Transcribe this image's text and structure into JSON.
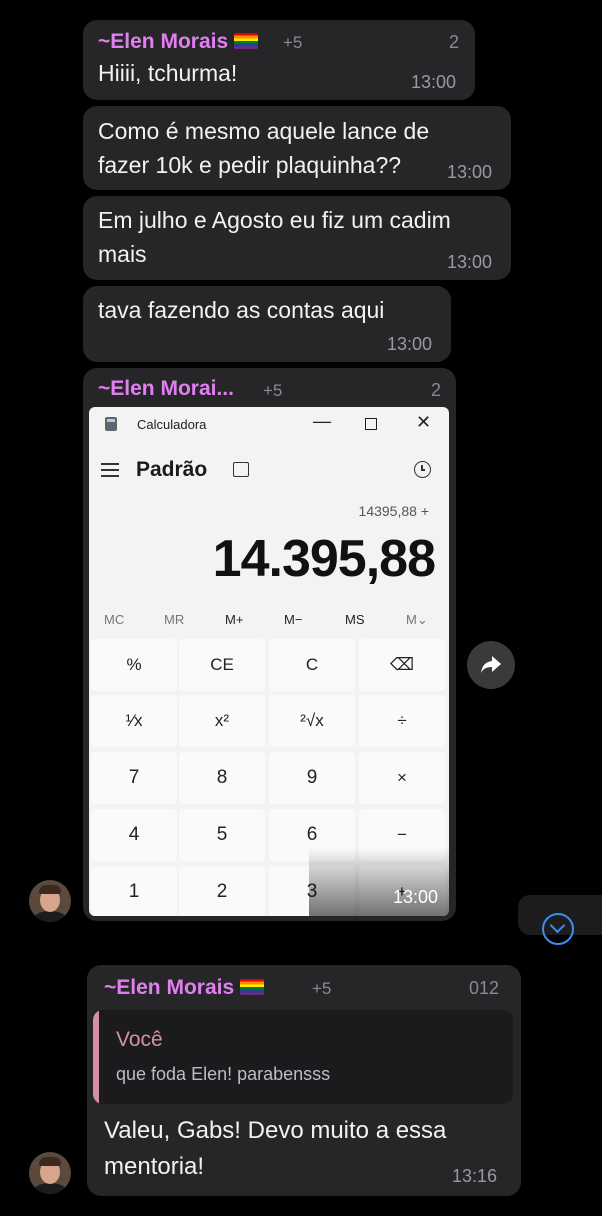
{
  "messages": [
    {
      "sender": "~Elen Morais",
      "plus": "+5",
      "count": "2",
      "text": "Hiiii, tchurma!",
      "time": "13:00"
    },
    {
      "line1": "Como é mesmo aquele lance de",
      "line2": "fazer 10k e pedir plaquinha??",
      "time": "13:00"
    },
    {
      "line1": "Em julho e Agosto eu fiz um cadim",
      "line2": "mais",
      "time": "13:00"
    },
    {
      "text": "tava fazendo as contas aqui",
      "time": "13:00"
    }
  ],
  "image_message": {
    "sender": "~Elen Morai...",
    "plus": "+5",
    "count": "2",
    "time": "13:00"
  },
  "calculator": {
    "window_title": "Calculadora",
    "mode": "Padrão",
    "expression": "14395,88 +",
    "display": "14.395,88",
    "memory_buttons": [
      "MC",
      "MR",
      "M+",
      "M−",
      "MS",
      "M⌄"
    ],
    "keys": [
      [
        "%",
        "CE",
        "C",
        "⌫"
      ],
      [
        "¹⁄x",
        "x²",
        "²√x",
        "÷"
      ],
      [
        "7",
        "8",
        "9",
        "×"
      ],
      [
        "4",
        "5",
        "6",
        "−"
      ],
      [
        "1",
        "2",
        "3",
        "+"
      ]
    ]
  },
  "last_message": {
    "sender": "~Elen Morais",
    "plus": "+5",
    "count": "012",
    "reply_author": "Você",
    "reply_text": "que foda Elen! parabensss",
    "line1": "Valeu, Gabs! Devo muito a essa",
    "line2": "mentoria!",
    "time": "13:16"
  },
  "colors": {
    "sender": "#e27ff0",
    "bubble": "#262628",
    "reply_bar": "#d58fa3"
  }
}
